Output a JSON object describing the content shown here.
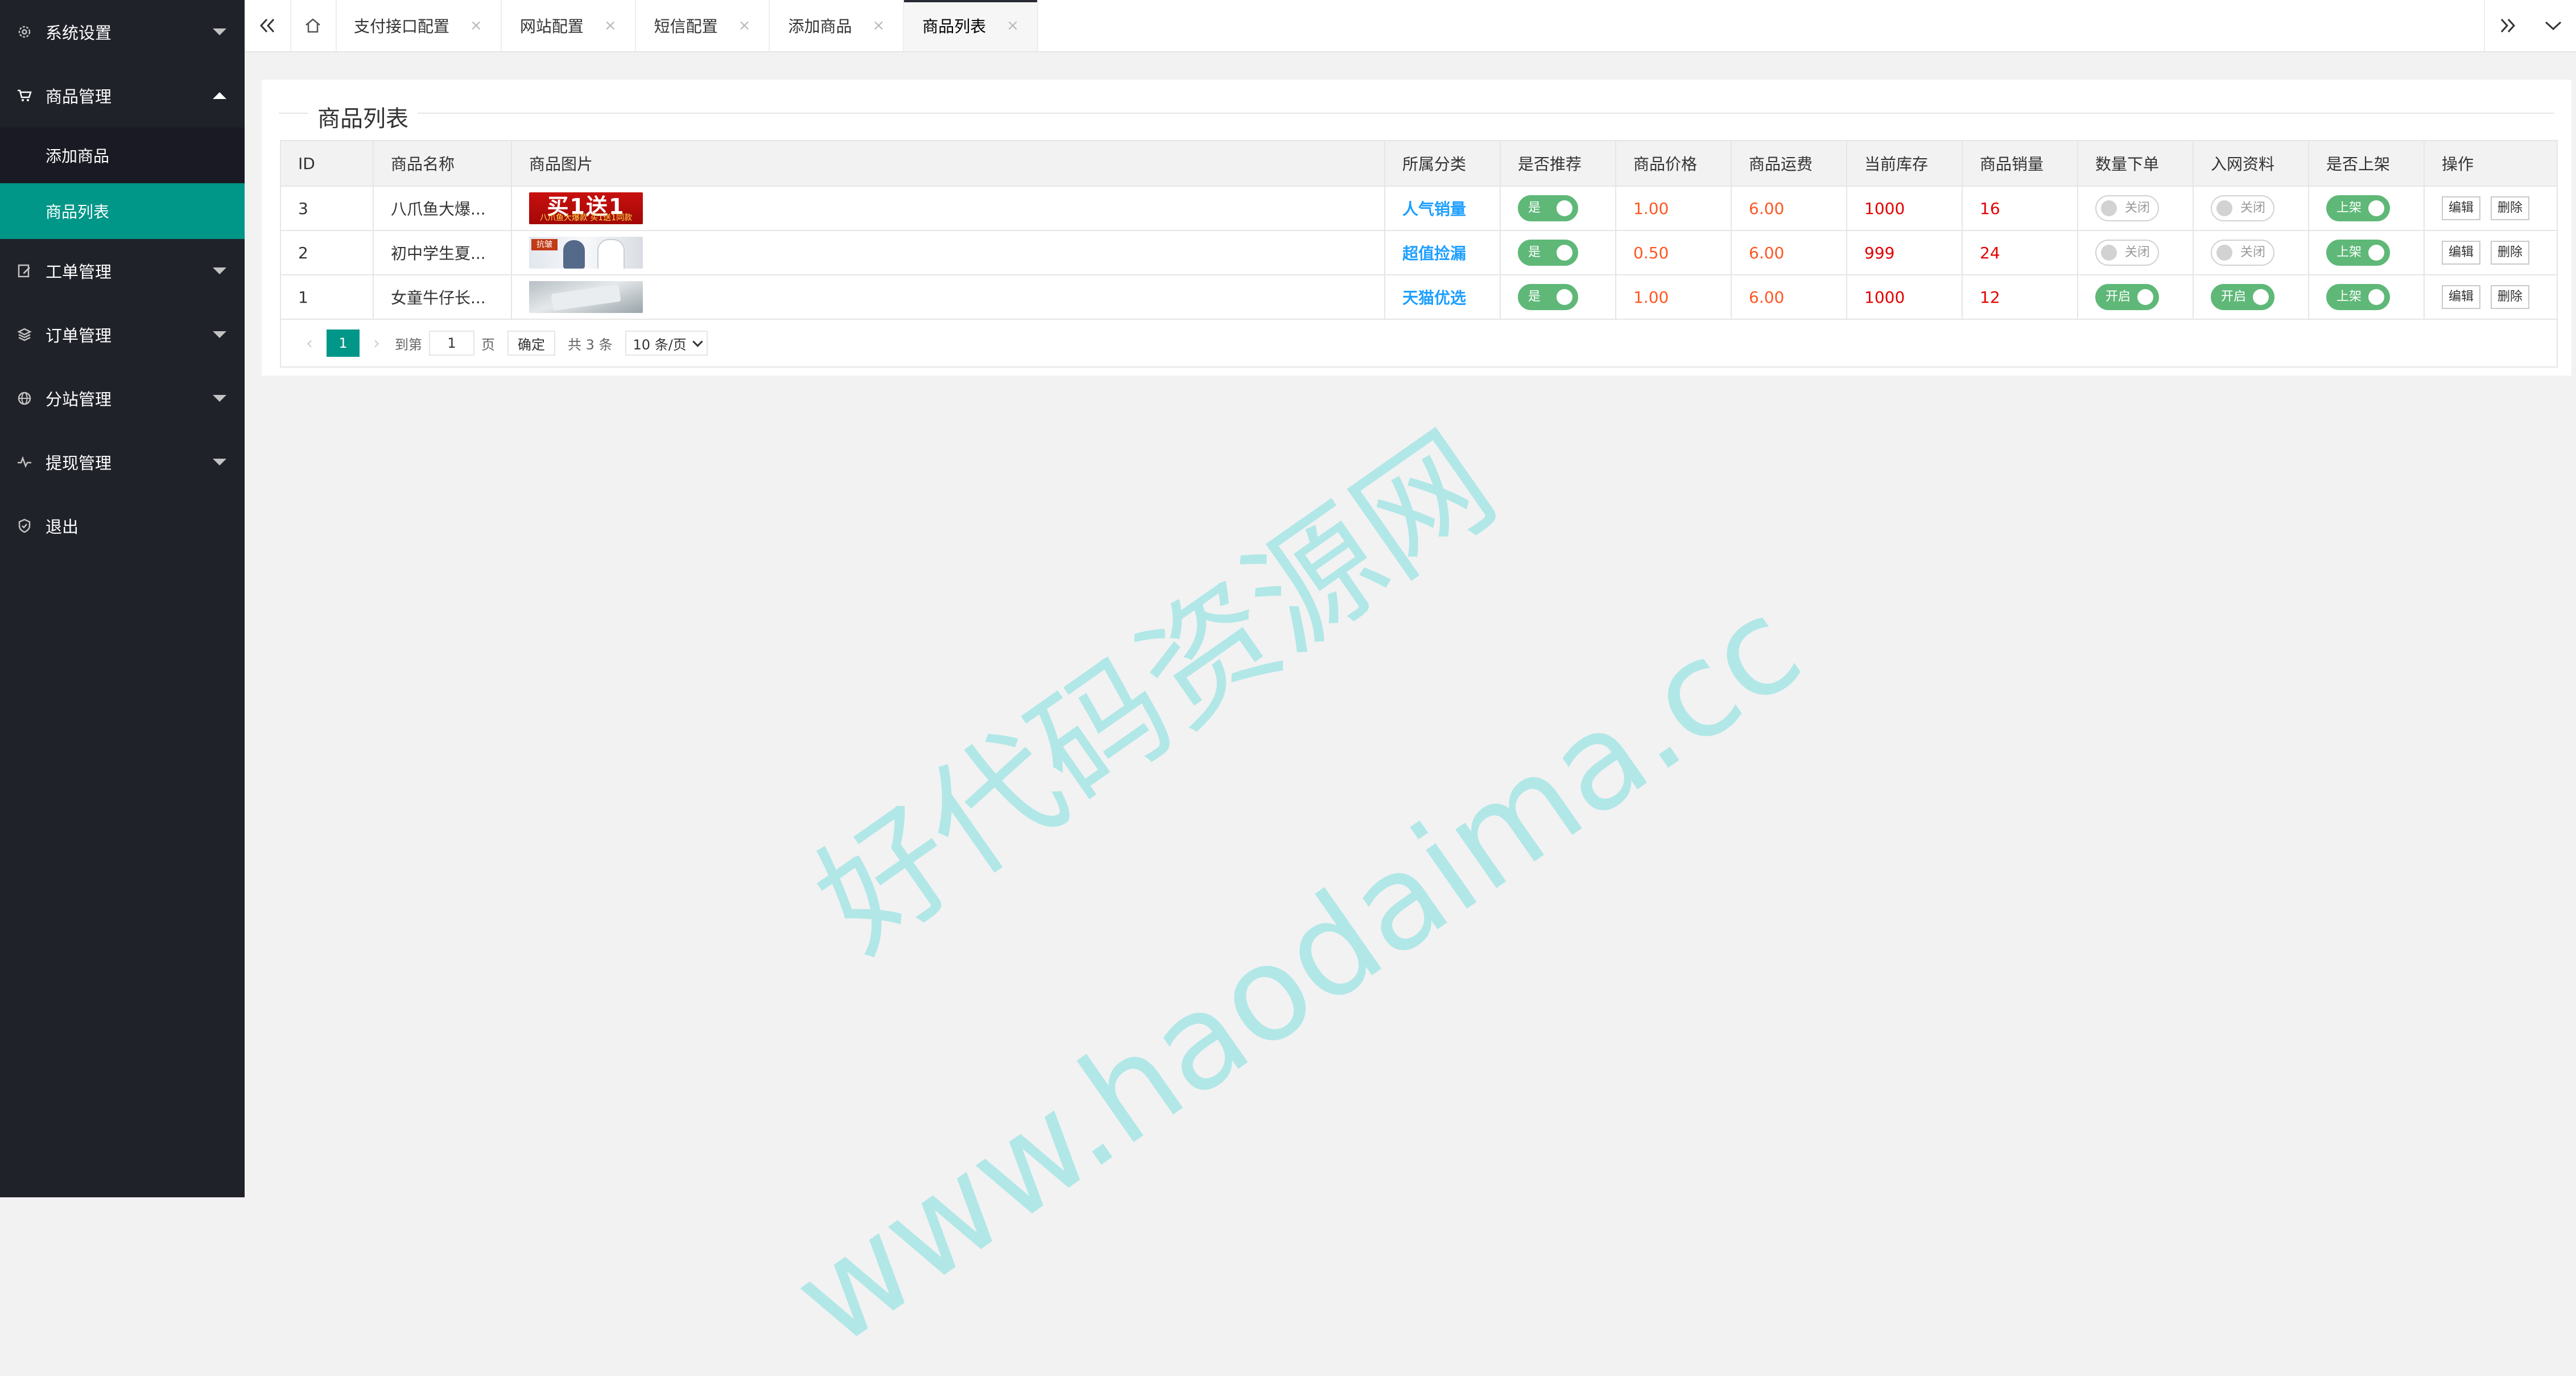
{
  "sidebar": {
    "items": [
      {
        "label": "系统设置",
        "icon": "gear-icon"
      },
      {
        "label": "商品管理",
        "icon": "cart-icon"
      },
      {
        "label": "工单管理",
        "icon": "edit-icon"
      },
      {
        "label": "订单管理",
        "icon": "layers-icon"
      },
      {
        "label": "分站管理",
        "icon": "globe-icon"
      },
      {
        "label": "提现管理",
        "icon": "pulse-icon"
      },
      {
        "label": "退出",
        "icon": "shield-icon"
      }
    ],
    "submenu": [
      {
        "label": "添加商品"
      },
      {
        "label": "商品列表"
      }
    ]
  },
  "tabs": [
    {
      "label": "支付接口配置"
    },
    {
      "label": "网站配置"
    },
    {
      "label": "短信配置"
    },
    {
      "label": "添加商品"
    },
    {
      "label": "商品列表"
    }
  ],
  "tab_close_glyph": "×",
  "panel": {
    "title": "商品列表"
  },
  "table": {
    "headers": [
      "ID",
      "商品名称",
      "商品图片",
      "所属分类",
      "是否推荐",
      "商品价格",
      "商品运费",
      "当前库存",
      "商品销量",
      "数量下单",
      "入网资料",
      "是否上架",
      "操作"
    ],
    "rows": [
      {
        "id": "3",
        "name": "八爪鱼大爆...",
        "img_text": "买1送1",
        "img_sub": "八爪鱼大爆款 买1送1同款",
        "category": "人气销量",
        "recommend": "是",
        "price": "1.00",
        "shipping": "6.00",
        "stock": "1000",
        "sales": "16",
        "qty_order": "关闭",
        "net_info": "关闭",
        "shelf": "上架",
        "edit": "编辑",
        "delete": "删除"
      },
      {
        "id": "2",
        "name": "初中学生夏...",
        "img_text": "抗皱",
        "category": "超值捡漏",
        "recommend": "是",
        "price": "0.50",
        "shipping": "6.00",
        "stock": "999",
        "sales": "24",
        "qty_order": "关闭",
        "net_info": "关闭",
        "shelf": "上架",
        "edit": "编辑",
        "delete": "删除"
      },
      {
        "id": "1",
        "name": "女童牛仔长...",
        "category": "天猫优选",
        "recommend": "是",
        "price": "1.00",
        "shipping": "6.00",
        "stock": "1000",
        "sales": "12",
        "qty_order": "开启",
        "net_info": "开启",
        "shelf": "上架",
        "edit": "编辑",
        "delete": "删除"
      }
    ]
  },
  "pagination": {
    "prev": "‹",
    "current": "1",
    "next": "›",
    "goto_label": "到第",
    "goto_value": "1",
    "page_label": "页",
    "confirm": "确定",
    "total": "共 3 条",
    "per_page": "10 条/页"
  },
  "watermark": {
    "line1": "好代码资源网",
    "line2": "www.haodaima.cc"
  },
  "colors": {
    "sidebar_bg": "#20222a",
    "accent": "#009688",
    "switch_on": "#5fb878",
    "link": "#1e9fff",
    "price": "#ff5722",
    "stock": "#e30000"
  }
}
